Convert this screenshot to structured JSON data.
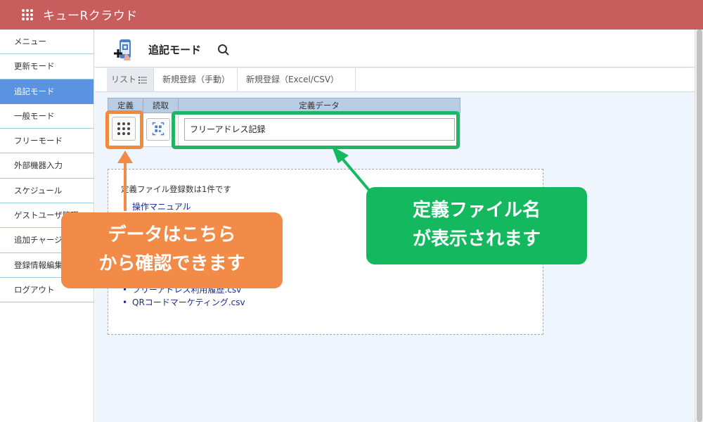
{
  "header": {
    "app_title": "キューRクラウド"
  },
  "sidebar": {
    "items": [
      {
        "label": "メニュー"
      },
      {
        "label": "更新モード"
      },
      {
        "label": "追記モード"
      },
      {
        "label": "一般モード"
      },
      {
        "label": "フリーモード"
      },
      {
        "label": "外部機器入力"
      },
      {
        "label": "スケジュール"
      },
      {
        "label": "ゲストユーザ管理"
      },
      {
        "label": "追加チャージ"
      },
      {
        "label": "登録情報編集"
      },
      {
        "label": "ログアウト"
      }
    ]
  },
  "page": {
    "title": "追記モード"
  },
  "tabs": [
    {
      "label": "リスト"
    },
    {
      "label": "新規登録（手動）"
    },
    {
      "label": "新規登録（Excel/CSV）"
    }
  ],
  "definition_table": {
    "headers": {
      "definition": "定義",
      "read": "読取",
      "data": "定義データ"
    },
    "file_name": "フリーアドレス記録"
  },
  "file_panel": {
    "count_text": "定義ファイル登録数は1件です",
    "links": [
      "操作マニュアル",
      "フリーアドレス利用履歴.csv",
      "QRコードマーケティング.csv"
    ]
  },
  "callouts": {
    "orange_line1": "データはこちら",
    "orange_line2": "から確認できます",
    "green_line1": "定義ファイル名",
    "green_line2": "が表示されます"
  },
  "colors": {
    "header": "#c85d5d",
    "sidebar_active": "#5b93e0",
    "callout_orange": "#f28a48",
    "callout_green": "#14b85f",
    "link": "#1b2a8f"
  }
}
